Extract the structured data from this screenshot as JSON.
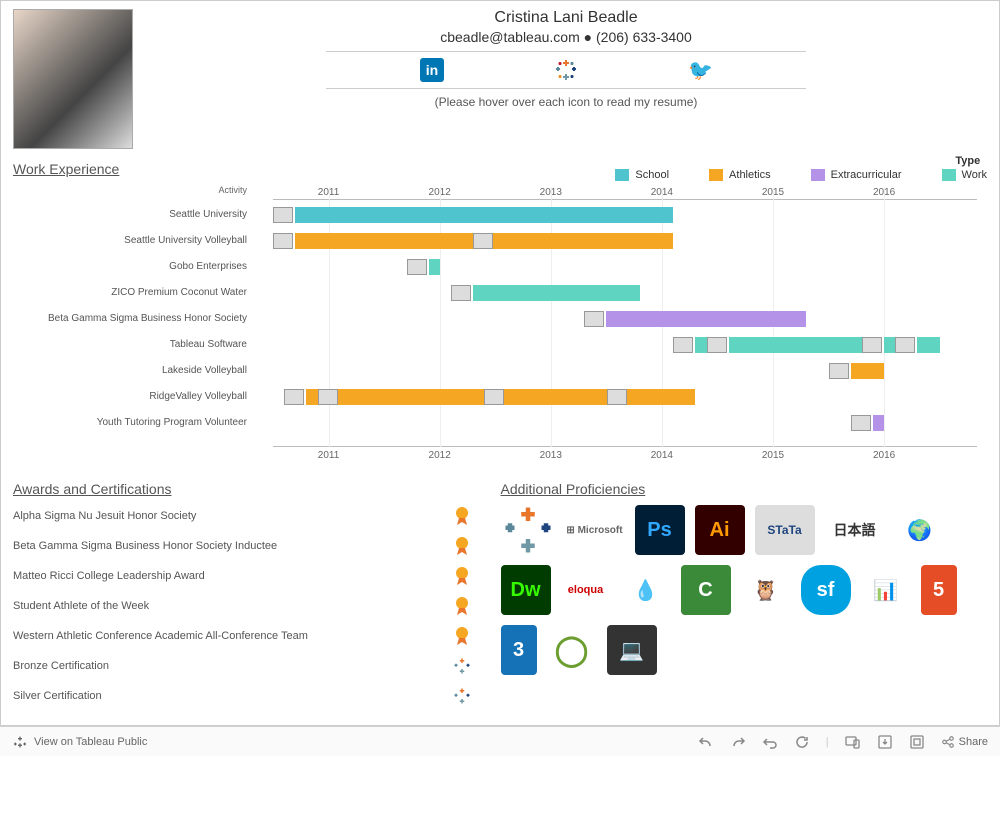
{
  "name": "Cristina Lani Beadle",
  "email": "cbeadle@tableau.com",
  "phone": "(206) 633-3400",
  "hint": "(Please hover over each icon to read my resume)",
  "typeLabel": "Type",
  "legend": {
    "school": "School",
    "athletics": "Athletics",
    "extra": "Extracurricular",
    "work": "Work"
  },
  "sections": {
    "work": "Work Experience",
    "awards": "Awards and Certifications",
    "prof": "Additional Proficiencies"
  },
  "axisHeader": "Activity",
  "years": [
    "2011",
    "2012",
    "2013",
    "2014",
    "2015",
    "2016"
  ],
  "activities": [
    "Seattle University",
    "Seattle University Volleyball",
    "Gobo Enterprises",
    "ZICO Premium Coconut Water",
    "Beta Gamma Sigma Business Honor Society",
    "Tableau Software",
    "Lakeside Volleyball",
    "RidgeValley Volleyball",
    "Youth Tutoring Program Volunteer"
  ],
  "awards": [
    "Alpha Sigma Nu Jesuit Honor Society",
    "Beta Gamma Sigma Business Honor Society Inductee",
    "Matteo Ricci College Leadership Award",
    "Student Athlete of the Week",
    "Western Athletic Conference Academic All-Conference Team",
    "Bronze Certification",
    "Silver Certification"
  ],
  "proficiencies": [
    "Tableau",
    "Microsoft",
    "Ps",
    "Ai",
    "STATA",
    "日本語",
    "Globe",
    "Dw",
    "eloqua",
    "Drupal",
    "C",
    "Hootsuite",
    "salesforce",
    "Analytics",
    "HTML5",
    "CSS3",
    "Webex",
    "Laptop"
  ],
  "toolbar": {
    "view": "View on Tableau Public",
    "share": "Share"
  },
  "chart_data": {
    "type": "gantt",
    "title": "Work Experience",
    "xlabel": "Year",
    "xlim": [
      2010.5,
      2016.8
    ],
    "categories": [
      "Seattle University",
      "Seattle University Volleyball",
      "Gobo Enterprises",
      "ZICO Premium Coconut Water",
      "Beta Gamma Sigma Business Honor Society",
      "Tableau Software",
      "Lakeside Volleyball",
      "RidgeValley Volleyball",
      "Youth Tutoring Program Volunteer"
    ],
    "color_by": "Type",
    "color_levels": {
      "School": "#4fc4cf",
      "Athletics": "#f5a623",
      "Extracurricular": "#b392e8",
      "Work": "#5fd4c0"
    },
    "bars": [
      {
        "activity": "Seattle University",
        "start": 2010.7,
        "end": 2014.1,
        "type": "School"
      },
      {
        "activity": "Seattle University Volleyball",
        "start": 2010.7,
        "end": 2012.5,
        "type": "Athletics"
      },
      {
        "activity": "Seattle University Volleyball",
        "start": 2012.5,
        "end": 2014.1,
        "type": "Athletics"
      },
      {
        "activity": "Gobo Enterprises",
        "start": 2011.9,
        "end": 2012.0,
        "type": "Work"
      },
      {
        "activity": "ZICO Premium Coconut Water",
        "start": 2012.3,
        "end": 2013.8,
        "type": "Work"
      },
      {
        "activity": "Beta Gamma Sigma Business Honor Society",
        "start": 2013.5,
        "end": 2015.3,
        "type": "Extracurricular"
      },
      {
        "activity": "Tableau Software",
        "start": 2014.3,
        "end": 2014.5,
        "type": "Work"
      },
      {
        "activity": "Tableau Software",
        "start": 2014.6,
        "end": 2015.9,
        "type": "Work"
      },
      {
        "activity": "Tableau Software",
        "start": 2016.0,
        "end": 2016.2,
        "type": "Work"
      },
      {
        "activity": "Tableau Software",
        "start": 2016.3,
        "end": 2016.5,
        "type": "Work"
      },
      {
        "activity": "Lakeside Volleyball",
        "start": 2015.7,
        "end": 2016.0,
        "type": "Athletics"
      },
      {
        "activity": "RidgeValley Volleyball",
        "start": 2010.8,
        "end": 2011.1,
        "type": "Athletics"
      },
      {
        "activity": "RidgeValley Volleyball",
        "start": 2011.1,
        "end": 2012.6,
        "type": "Athletics"
      },
      {
        "activity": "RidgeValley Volleyball",
        "start": 2012.6,
        "end": 2013.7,
        "type": "Athletics"
      },
      {
        "activity": "RidgeValley Volleyball",
        "start": 2013.7,
        "end": 2014.3,
        "type": "Athletics"
      },
      {
        "activity": "Youth Tutoring Program Volunteer",
        "start": 2015.9,
        "end": 2016.0,
        "type": "Extracurricular"
      }
    ]
  }
}
